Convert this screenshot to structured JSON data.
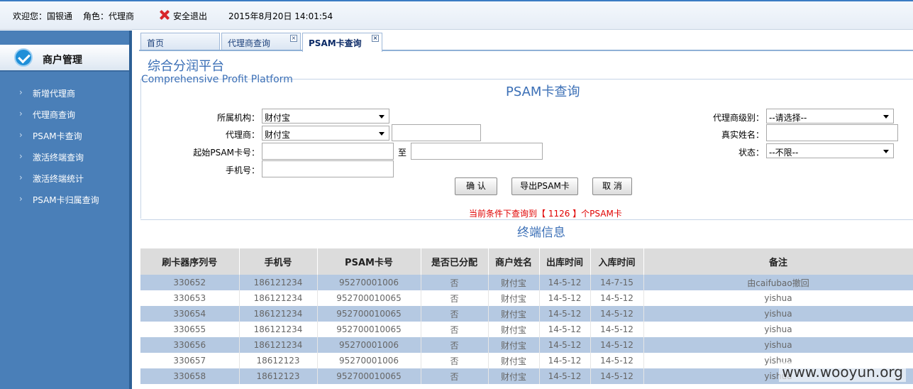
{
  "topbar": {
    "welcome": "欢迎您：国银通",
    "role": "角色：代理商",
    "logout": "安全退出",
    "datetime": "2015年8月20日  14:01:54"
  },
  "sidebar": {
    "title": "商户管理",
    "items": [
      {
        "label": "新增代理商"
      },
      {
        "label": "代理商查询"
      },
      {
        "label": "PSAM卡查询"
      },
      {
        "label": "激活终端查询"
      },
      {
        "label": "激活终端统计"
      },
      {
        "label": "PSAM卡归属查询"
      }
    ]
  },
  "tabs": [
    {
      "label": "首页"
    },
    {
      "label": "代理商查询"
    },
    {
      "label": "PSAM卡查询"
    }
  ],
  "platform": {
    "cn": "综合分润平台",
    "en": "Comprehensive Profit Platform"
  },
  "form": {
    "title": "PSAM卡查询",
    "org_label": "所属机构：",
    "org_value": "财付宝",
    "agent_label": "代理商：",
    "agent_value": "财付宝",
    "agent_text": "",
    "start_label": "起始PSAM卡号：",
    "start_value": "",
    "to_label": "至",
    "end_value": "",
    "phone_label": "手机号：",
    "phone_value": "",
    "level_label": "代理商级别：",
    "level_value": "--请选择--",
    "realname_label": "真实姓名：",
    "realname_value": "",
    "status_label": "状态：",
    "status_value": "--不限--",
    "confirm": "确  认",
    "export": "导出PSAM卡",
    "cancel": "取  消"
  },
  "result_msg": "当前条件下查询到【 1126 】个PSAM卡",
  "section_title": "终端信息",
  "table": {
    "headers": [
      "刷卡器序列号",
      "手机号",
      "PSAM卡号",
      "是否已分配",
      "商户姓名",
      "出库时间",
      "入库时间",
      "备注"
    ],
    "rows": [
      [
        "330652",
        "186121234",
        "95270001006",
        "否",
        "财付宝",
        "14-5-12",
        "14-7-15",
        "由caifubao撤回"
      ],
      [
        "330653",
        "186121234",
        "952700010065",
        "否",
        "财付宝",
        "14-5-12",
        "14-5-12",
        "yishua"
      ],
      [
        "330654",
        "186121234",
        "952700010065",
        "否",
        "财付宝",
        "14-5-12",
        "14-5-12",
        "yishua"
      ],
      [
        "330655",
        "186121234",
        "952700010065",
        "否",
        "财付宝",
        "14-5-12",
        "14-5-12",
        "yishua"
      ],
      [
        "330656",
        "186121234",
        "95270001006",
        "否",
        "财付宝",
        "14-5-12",
        "14-5-12",
        "yishua"
      ],
      [
        "330657",
        "18612123",
        "95270001006",
        "否",
        "财付宝",
        "14-5-12",
        "14-5-12",
        "yishua"
      ],
      [
        "330658",
        "18612123",
        "952700010065",
        "否",
        "财付宝",
        "14-5-12",
        "14-5-12",
        "yishua"
      ]
    ]
  },
  "watermark": "www.wooyun.org"
}
